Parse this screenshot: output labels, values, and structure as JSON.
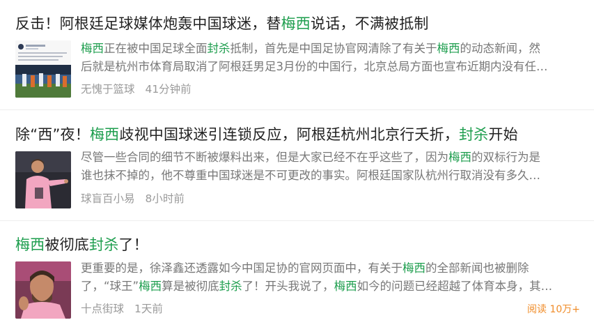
{
  "articles": [
    {
      "title": [
        {
          "t": "反击！阿根廷足球媒体炮轰中国球迷，替"
        },
        {
          "t": "梅西",
          "hl": true
        },
        {
          "t": "说话，不满被抵制"
        }
      ],
      "summary_lines": [
        [
          {
            "t": "梅西",
            "hl": true
          },
          {
            "t": "正在被中国足球全面"
          },
          {
            "t": "封杀",
            "hl": true
          },
          {
            "t": "抵制，首先是中国足协官网清除了有关于"
          },
          {
            "t": "梅西",
            "hl": true
          },
          {
            "t": "的动态新闻，然"
          }
        ],
        [
          {
            "t": "后就是杭州市体育局取消了阿根廷男足3月份的中国行，北京总局方面也宣布近期内没有任…"
          }
        ]
      ],
      "source": "无愧于篮球",
      "time": "41分钟前"
    },
    {
      "title": [
        {
          "t": "除“西”夜！"
        },
        {
          "t": "梅西",
          "hl": true
        },
        {
          "t": "歧视中国球迷引连锁反应，阿根廷杭州北京行夭折，"
        },
        {
          "t": "封杀",
          "hl": true
        },
        {
          "t": "开始"
        }
      ],
      "summary_lines": [
        [
          {
            "t": "尽管一些合同的细节不断被爆料出来，但是大家已经不在乎这些了，因为"
          },
          {
            "t": "梅西",
            "hl": true
          },
          {
            "t": "的双标行为是"
          }
        ],
        [
          {
            "t": "谁也抹不掉的，他不尊重中国球迷是不可更改的事实。阿根廷国家队杭州行取消没有多久…"
          }
        ]
      ],
      "source": "球盲百小易",
      "time": "8小时前"
    },
    {
      "title": [
        {
          "t": "梅西",
          "hl": true
        },
        {
          "t": "被彻底"
        },
        {
          "t": "封杀",
          "hl": true
        },
        {
          "t": "了！"
        }
      ],
      "summary_lines": [
        [
          {
            "t": "更重要的是，徐泽鑫还透露如今中国足协的官网页面中，有关于"
          },
          {
            "t": "梅西",
            "hl": true
          },
          {
            "t": "的全部新闻也被删除"
          }
        ],
        [
          {
            "t": "了，“球王”"
          },
          {
            "t": "梅西",
            "hl": true
          },
          {
            "t": "算是被彻底"
          },
          {
            "t": "封杀",
            "hl": true
          },
          {
            "t": "了！开头我说了，"
          },
          {
            "t": "梅西",
            "hl": true
          },
          {
            "t": "如今的问题已经超越了体育本身，其…"
          }
        ]
      ],
      "source": "十点街球",
      "time": "1天前",
      "reads": "阅读 10万+"
    }
  ],
  "colors": {
    "highlight": "#1e9e4e",
    "title": "#222222",
    "summary": "#777777",
    "meta": "#9a9a9a",
    "reads": "#f08c28"
  }
}
